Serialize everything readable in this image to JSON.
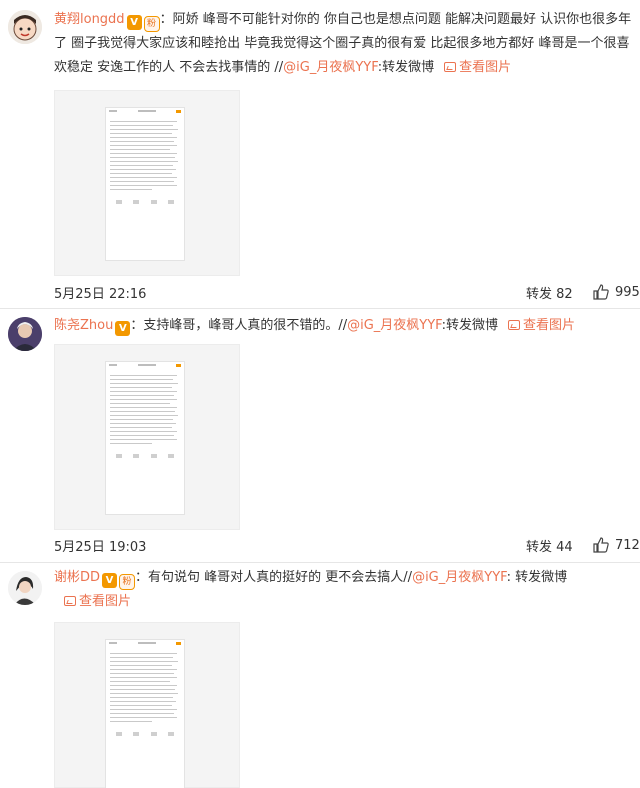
{
  "comments": [
    {
      "username": "黄翔longdd",
      "verified_badge": "V",
      "fan_badge": "粉",
      "text": "：阿娇  峰哥不可能针对你的  你自己也是想点问题  能解决问题最好  认识你也很多年了  圈子我觉得大家应该和睦抢出  毕竟我觉得这个圈子真的很有爱  比起很多地方都好  峰哥是一个很喜欢稳定 安逸工作的人  不会去找事情的 //",
      "mention": "@iG_月夜枫YYF",
      "suffix": ":转发微博",
      "view_image": "查看图片",
      "time": "5月25日 22:16",
      "repost_label": "转发",
      "repost_count": "82",
      "like_count": "995",
      "avatar_icon": "cartoon-face-icon"
    },
    {
      "username": "陈尧Zhou",
      "verified_badge": "V",
      "fan_badge": "",
      "text": "：支持峰哥，峰哥人真的很不错的。//",
      "mention": "@iG_月夜枫YYF",
      "suffix": ":转发微博",
      "view_image": "查看图片",
      "time": "5月25日 19:03",
      "repost_label": "转发",
      "repost_count": "44",
      "like_count": "712",
      "avatar_icon": "user-photo-icon"
    },
    {
      "username": "谢彬DD",
      "verified_badge": "V",
      "fan_badge": "粉",
      "text": "：有句说句  峰哥对人真的挺好的  更不会去搞人//",
      "mention": "@iG_月夜枫YYF",
      "suffix": ": 转发微博",
      "view_image": "查看图片",
      "avatar_icon": "user-photo-icon"
    }
  ],
  "colors": {
    "username": "#eb7350",
    "link": "#eb7350",
    "badge": "#f39800"
  }
}
